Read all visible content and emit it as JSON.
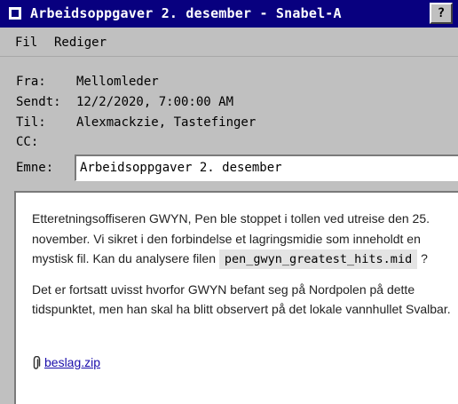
{
  "window": {
    "title": "Arbeidsoppgaver 2. desember - Snabel-A",
    "help_label": "?"
  },
  "menu": {
    "items": [
      "Fil",
      "Rediger"
    ]
  },
  "headers": {
    "from_label": "Fra:",
    "from_value": "Mellomleder",
    "sent_label": "Sendt:",
    "sent_value": "12/2/2020, 7:00:00 AM",
    "to_label": "Til:",
    "to_value": "Alexmackzie, Tastefinger",
    "cc_label": "CC:",
    "cc_value": "",
    "subject_label": "Emne:",
    "subject_value": "Arbeidsoppgaver 2. desember"
  },
  "body": {
    "p1_before": "Etteretningsoffiseren GWYN, Pen ble stoppet i tollen ved utreise den 25. november. Vi sikret i den forbindelse et lagringsmidie som inneholdt en mystisk fil. Kan du analysere filen ",
    "p1_code": "pen_gwyn_greatest_hits.mid",
    "p1_after": " ?",
    "p2": "Det er fortsatt uvisst hvorfor GWYN befant seg på Nordpolen på dette tidspunktet, men han skal ha blitt observert på det lokale vannhullet Svalbar."
  },
  "attachment": {
    "icon": "paperclip-icon",
    "filename": "beslag.zip"
  }
}
